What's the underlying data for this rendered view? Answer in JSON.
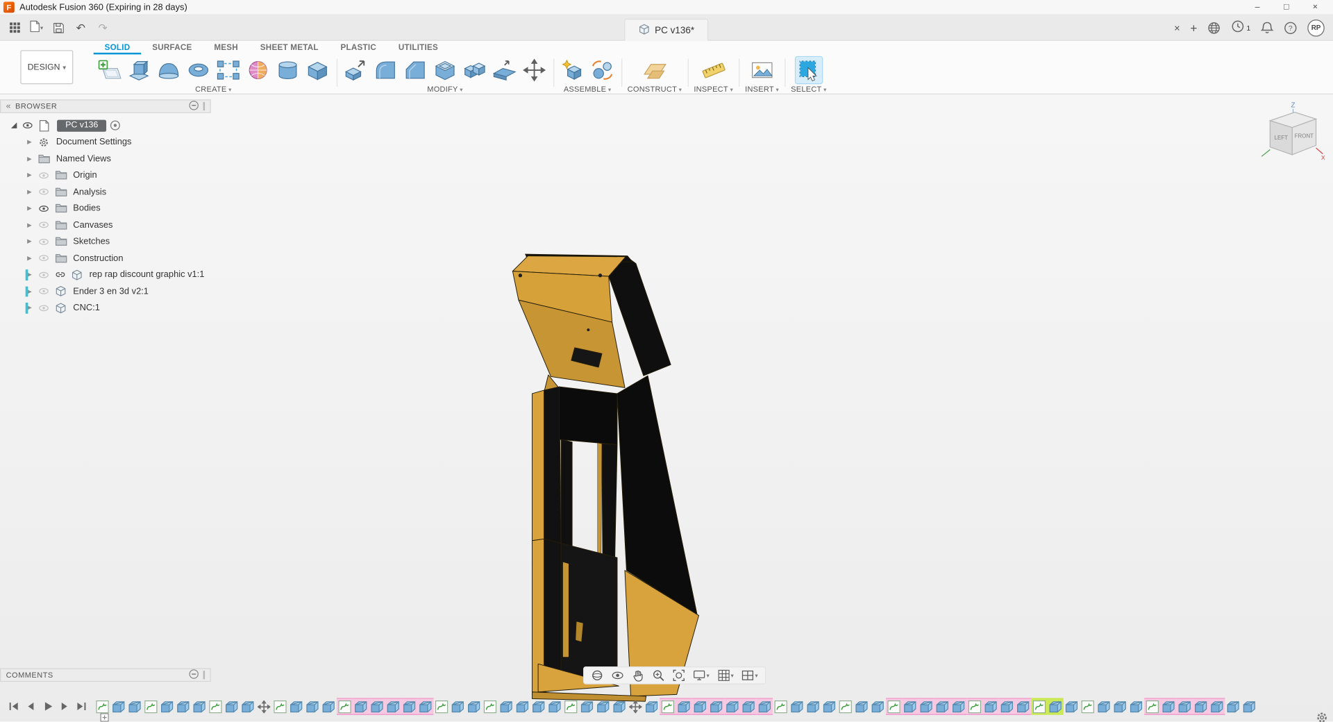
{
  "window": {
    "title": "Autodesk Fusion 360 (Expiring in 28 days)",
    "logo_letter": "F",
    "controls": {
      "minimize": "–",
      "maximize": "□",
      "close": "×"
    }
  },
  "tabbar": {
    "document_tab": "PC v136*",
    "close_label": "×",
    "new_tab_label": "+",
    "job_count": "1",
    "avatar_initials": "RP"
  },
  "ribbon": {
    "design_label": "DESIGN",
    "tabs": [
      {
        "label": "SOLID",
        "active": true
      },
      {
        "label": "SURFACE"
      },
      {
        "label": "MESH"
      },
      {
        "label": "SHEET METAL"
      },
      {
        "label": "PLASTIC"
      },
      {
        "label": "UTILITIES"
      }
    ],
    "groups": [
      {
        "label": "CREATE",
        "icons": [
          "create-sketch",
          "extrude",
          "sweep",
          "revolve",
          "pattern",
          "form",
          "cylinder",
          "box"
        ]
      },
      {
        "label": "MODIFY",
        "icons": [
          "press-pull",
          "fillet",
          "chamfer",
          "shell",
          "combine",
          "replace-face",
          "move"
        ]
      },
      {
        "label": "ASSEMBLE",
        "icons": [
          "new-component",
          "joint"
        ]
      },
      {
        "label": "CONSTRUCT",
        "icons": [
          "construction-plane"
        ]
      },
      {
        "label": "INSPECT",
        "icons": [
          "measure"
        ]
      },
      {
        "label": "INSERT",
        "icons": [
          "insert-image"
        ]
      },
      {
        "label": "SELECT",
        "icons": [
          "select"
        ]
      }
    ]
  },
  "browser": {
    "header": "BROWSER",
    "root_label": "PC v136",
    "items": [
      {
        "label": "Document Settings",
        "icons": [
          "gear"
        ]
      },
      {
        "label": "Named Views",
        "icons": [
          "folder"
        ]
      },
      {
        "label": "Origin",
        "icons": [
          "folder"
        ],
        "eye": "light"
      },
      {
        "label": "Analysis",
        "icons": [
          "folder"
        ],
        "eye": "light"
      },
      {
        "label": "Bodies",
        "icons": [
          "folder"
        ],
        "eye": "dark"
      },
      {
        "label": "Canvases",
        "icons": [
          "folder"
        ],
        "eye": "light"
      },
      {
        "label": "Sketches",
        "icons": [
          "folder"
        ],
        "eye": "light"
      },
      {
        "label": "Construction",
        "icons": [
          "folder"
        ],
        "eye": "light"
      },
      {
        "label": "rep rap discount graphic v1:1",
        "icons": [
          "link",
          "cube"
        ],
        "eye": "light",
        "accent": true
      },
      {
        "label": "Ender 3 en 3d v2:1",
        "icons": [
          "cube"
        ],
        "eye": "light",
        "accent": true
      },
      {
        "label": "CNC:1",
        "icons": [
          "cube"
        ],
        "eye": "light",
        "accent": true
      }
    ]
  },
  "viewcube": {
    "z": "Z",
    "x": "X",
    "left": "LEFT",
    "front": "FRONT"
  },
  "navbar": {
    "items": [
      {
        "name": "orbit"
      },
      {
        "name": "look-at"
      },
      {
        "name": "pan"
      },
      {
        "name": "zoom"
      },
      {
        "name": "fit"
      },
      {
        "name": "display-settings",
        "dropdown": true
      },
      {
        "name": "grid-settings",
        "dropdown": true
      },
      {
        "name": "viewports",
        "dropdown": true
      }
    ]
  },
  "comments": {
    "header": "COMMENTS"
  },
  "timeline": {
    "playback": [
      "go-to-start",
      "step-back",
      "play",
      "step-forward",
      "go-to-end"
    ],
    "icons": [
      "s",
      "f",
      "f",
      "s",
      "f",
      "f",
      "f",
      "s",
      "f",
      "f",
      "m",
      "s",
      "f",
      "f",
      "f",
      "sP",
      "fP",
      "fP",
      "fP",
      "fP",
      "fP",
      "s",
      "f",
      "f",
      "s",
      "f",
      "f",
      "f",
      "f",
      "s",
      "f",
      "f",
      "f",
      "m",
      "f",
      "sP",
      "fP",
      "fP",
      "fP",
      "fP",
      "fP",
      "fP",
      "s",
      "f",
      "f",
      "f",
      "s",
      "f",
      "f",
      "sP",
      "fP",
      "fP",
      "fP",
      "fP",
      "sP",
      "fP",
      "fP",
      "fP",
      "sH",
      "fH",
      "f",
      "s",
      "f",
      "f",
      "f",
      "sP",
      "fP",
      "fP",
      "fP",
      "fP",
      "f",
      "f"
    ]
  },
  "colors": {
    "accent_blue": "#0696d7",
    "model_yellow": "#d8a33c",
    "model_black": "#101010",
    "timeline_pink": "#f7c8e1",
    "timeline_highlight": "#cbe957",
    "component_accent": "#35c4d8"
  }
}
